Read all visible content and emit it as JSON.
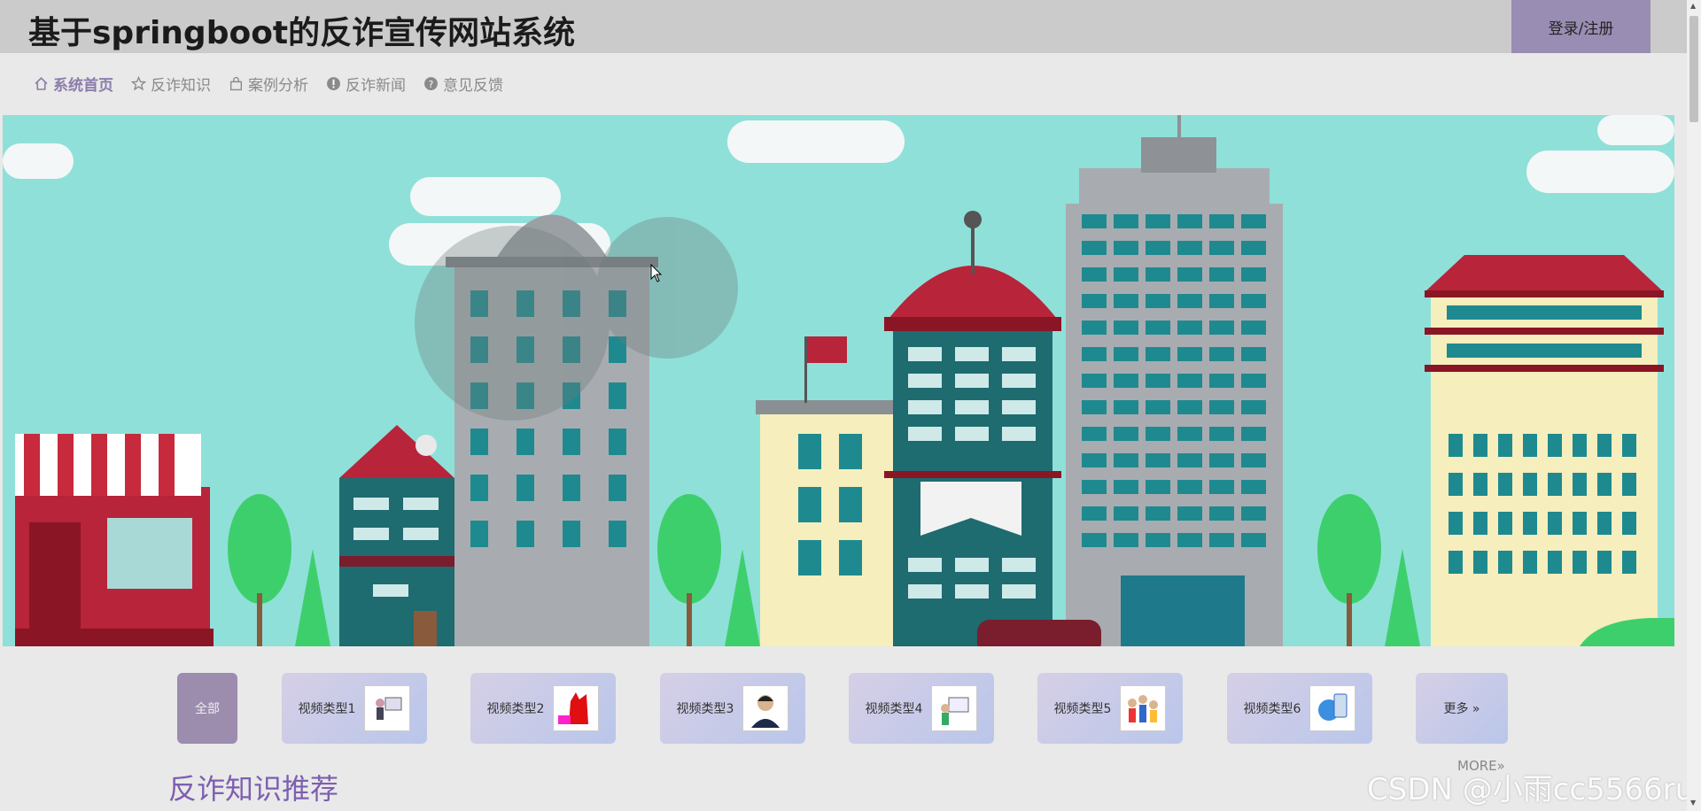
{
  "header": {
    "title": "基于springboot的反诈宣传网站系统",
    "login_label": "登录/注册"
  },
  "nav": {
    "items": [
      {
        "label": "系统首页",
        "icon": "home-icon",
        "active": true
      },
      {
        "label": "反诈知识",
        "icon": "star-icon",
        "active": false
      },
      {
        "label": "案例分析",
        "icon": "bag-icon",
        "active": false
      },
      {
        "label": "反诈新闻",
        "icon": "alert-icon",
        "active": false
      },
      {
        "label": "意见反馈",
        "icon": "question-icon",
        "active": false
      }
    ]
  },
  "banner": {
    "description_icon": "city-illustration",
    "colors": {
      "sky": "#8fe0d9",
      "red": "#b8243a",
      "teal": "#1e7a7e",
      "building_gray": "#a8acb0",
      "cream": "#f6eebc"
    }
  },
  "categories": {
    "all_label": "全部",
    "items": [
      {
        "label": "视频类型1"
      },
      {
        "label": "视频类型2"
      },
      {
        "label": "视频类型3"
      },
      {
        "label": "视频类型4"
      },
      {
        "label": "视频类型5"
      },
      {
        "label": "视频类型6"
      }
    ],
    "more_label": "更多 »"
  },
  "section": {
    "title": "反诈知识推荐",
    "more_label": "MORE»"
  },
  "watermark": "CSDN @小雨cc5566ru",
  "colors": {
    "accent": "#8c7cab",
    "header_bg": "#cbcbcb",
    "login_bg": "#9a8db3"
  }
}
